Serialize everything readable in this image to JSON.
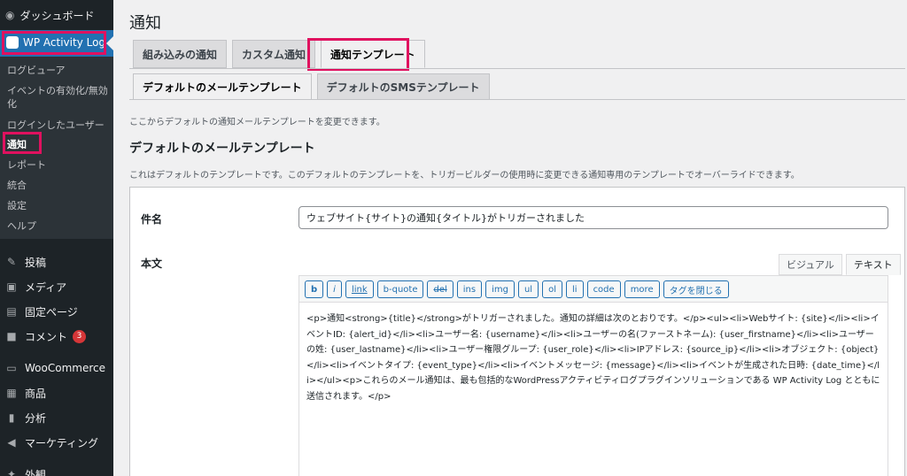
{
  "sidebar": {
    "dashboard": "ダッシュボード",
    "plugin": "WP Activity Log",
    "submenu": [
      "ログビューア",
      "イベントの有効化/無効\n化",
      "ログインしたユーザー",
      "通知",
      "レポート",
      "統合",
      "設定",
      "ヘルプ"
    ],
    "items": [
      {
        "label": "投稿",
        "icon": "pin-icon"
      },
      {
        "label": "メディア",
        "icon": "media-icon"
      },
      {
        "label": "固定ページ",
        "icon": "page-icon"
      },
      {
        "label": "コメント",
        "icon": "comment-icon",
        "badge": "3"
      },
      {
        "label": "WooCommerce",
        "icon": "woo-icon"
      },
      {
        "label": "商品",
        "icon": "product-icon"
      },
      {
        "label": "分析",
        "icon": "analytics-icon"
      },
      {
        "label": "マーケティング",
        "icon": "megaphone-icon"
      },
      {
        "label": "外観",
        "icon": "appearance-icon"
      }
    ]
  },
  "page": {
    "title": "通知",
    "tabs": [
      "組み込みの通知",
      "カスタム通知",
      "通知テンプレート"
    ],
    "subtabs": [
      "デフォルトのメールテンプレート",
      "デフォルトのSMSテンプレート"
    ],
    "intro": "ここからデフォルトの通知メールテンプレートを変更できます。",
    "section_title": "デフォルトのメールテンプレート",
    "description": "これはデフォルトのテンプレートです。このデフォルトのテンプレートを、トリガービルダーの使用時に変更できる通知専用のテンプレートでオーバーライドできます。",
    "subject_label": "件名",
    "subject_value": "ウェブサイト{サイト}の通知{タイトル}がトリガーされました",
    "body_label": "本文",
    "mode_tabs": [
      "ビジュアル",
      "テキスト"
    ],
    "quicktags": [
      "b",
      "i",
      "link",
      "b-quote",
      "del",
      "ins",
      "img",
      "ul",
      "ol",
      "li",
      "code",
      "more",
      "タグを閉じる"
    ],
    "body_text": "<p>通知<strong>{title}</strong>がトリガーされました。通知の詳細は次のとおりです。</p><ul><li>Webサイト: {site}</li><li>イベントID: {alert_id}</li><li>ユーザー名: {username}</li><li>ユーザーの名(ファーストネーム): {user_firstname}</li><li>ユーザーの姓: {user_lastname}</li><li>ユーザー権限グループ: {user_role}</li><li>IPアドレス: {source_ip}</li><li>オブジェクト: {object}</li><li>イベントタイプ: {event_type}</li><li>イベントメッセージ: {message}</li><li>イベントが生成された日時: {date_time}</li></ul><p>これらのメール通知は、最も包括的なWordPressアクティビティログプラグインソリューションである WP Activity Log とともに送信されます。</p>"
  },
  "colors": {
    "accent": "#2271b1",
    "highlight": "#e0115f",
    "sidebar": "#1d2327"
  }
}
